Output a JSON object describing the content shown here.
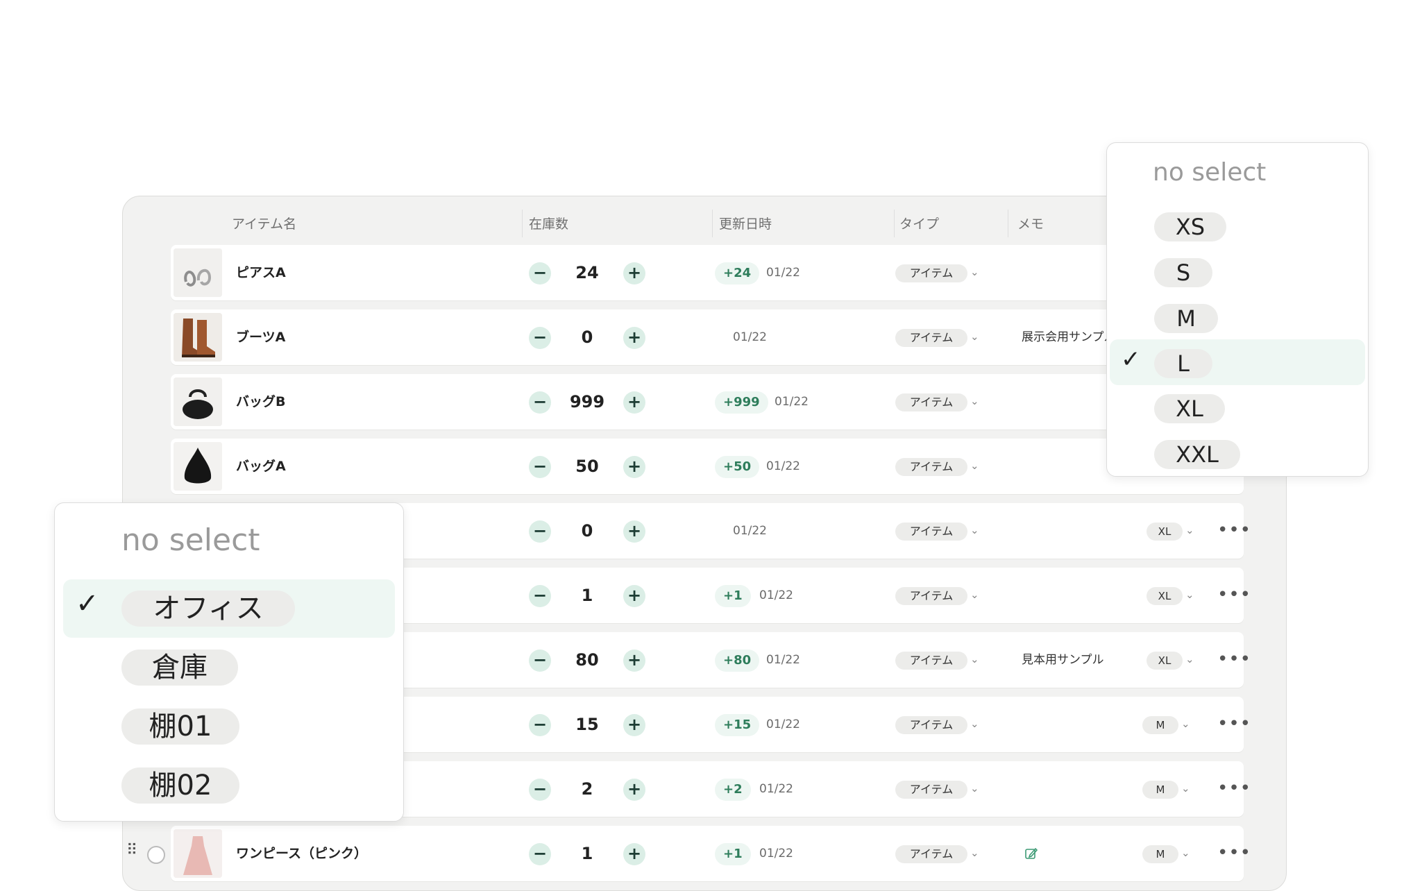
{
  "header": {
    "col_item": "アイテム名",
    "col_stock": "在庫数",
    "col_updated": "更新日時",
    "col_type": "タイプ",
    "col_memo": "メモ"
  },
  "rows": [
    {
      "name": "ピアスA",
      "qty": "24",
      "delta": "+24",
      "date": "01/22",
      "type": "アイテム",
      "memo": "",
      "size": "",
      "thumb": "earring"
    },
    {
      "name": "ブーツA",
      "qty": "0",
      "delta": "",
      "date": "01/22",
      "type": "アイテム",
      "memo": "展示会用サンプル",
      "size": "",
      "thumb": "boots"
    },
    {
      "name": "バッグB",
      "qty": "999",
      "delta": "+999",
      "date": "01/22",
      "type": "アイテム",
      "memo": "",
      "size": "",
      "thumb": "bag-round"
    },
    {
      "name": "バッグA",
      "qty": "50",
      "delta": "+50",
      "date": "01/22",
      "type": "アイテム",
      "memo": "",
      "size": "",
      "thumb": "bag-hobo"
    },
    {
      "name": "",
      "qty": "0",
      "delta": "",
      "date": "01/22",
      "type": "アイテム",
      "memo": "",
      "size": "XL"
    },
    {
      "name": "",
      "qty": "1",
      "delta": "+1",
      "date": "01/22",
      "type": "アイテム",
      "memo": "",
      "size": "XL"
    },
    {
      "name": "",
      "qty": "80",
      "delta": "+80",
      "date": "01/22",
      "type": "アイテム",
      "memo": "見本用サンプル",
      "size": "XL"
    },
    {
      "name": "",
      "qty": "15",
      "delta": "+15",
      "date": "01/22",
      "type": "アイテム",
      "memo": "",
      "size": "M"
    },
    {
      "name": "",
      "qty": "2",
      "delta": "+2",
      "date": "01/22",
      "type": "アイテム",
      "memo": "",
      "size": "M"
    },
    {
      "name": "ワンピース（ピンク）",
      "qty": "1",
      "delta": "+1",
      "date": "01/22",
      "type": "アイテム",
      "memo": "",
      "size": "M",
      "thumb": "dress"
    }
  ],
  "buttons": {
    "minus": "−",
    "plus": "+",
    "more": "•••"
  },
  "size_dropdown": {
    "placeholder": "no select",
    "options": [
      "XS",
      "S",
      "M",
      "L",
      "XL",
      "XXL"
    ],
    "selected": "L"
  },
  "location_dropdown": {
    "placeholder": "no select",
    "options": [
      "オフィス",
      "倉庫",
      "棚01",
      "棚02"
    ],
    "selected": "オフィス"
  },
  "colors": {
    "accent_green": "#2e7d5b",
    "step_button_bg": "#dbeee6",
    "selected_bg": "#eef7f3",
    "panel_bg": "#f2f2f1"
  },
  "icons": {
    "check": "✓",
    "chevron": "⌄",
    "drag": "⠿"
  }
}
